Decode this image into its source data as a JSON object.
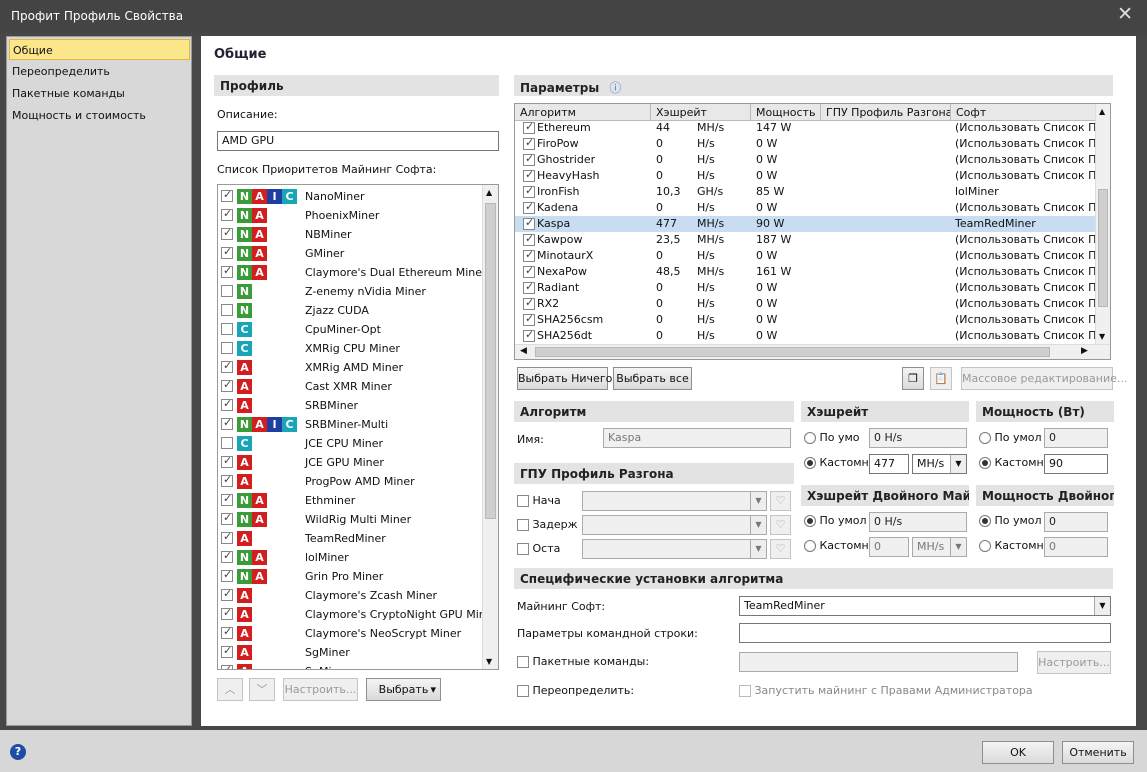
{
  "window": {
    "title": "Профит Профиль Свойства",
    "close": "✕"
  },
  "nav": {
    "items": [
      "Общие",
      "Переопределить",
      "Пакетные команды",
      "Мощность и стоимость"
    ]
  },
  "page_title": "Общие",
  "profile": {
    "section": "Профиль",
    "desc_label": "Описание:",
    "desc_value": "AMD GPU",
    "priority_label": "Список Приоритетов Майнинг Софта:"
  },
  "miners": [
    {
      "name": "NanoMiner",
      "on": true,
      "b": [
        "N",
        "A",
        "I",
        "C"
      ]
    },
    {
      "name": "PhoenixMiner",
      "on": true,
      "b": [
        "N",
        "A"
      ]
    },
    {
      "name": "NBMiner",
      "on": true,
      "b": [
        "N",
        "A"
      ]
    },
    {
      "name": "GMiner",
      "on": true,
      "b": [
        "N",
        "A"
      ]
    },
    {
      "name": "Claymore's Dual Ethereum Miner",
      "on": true,
      "b": [
        "N",
        "A"
      ]
    },
    {
      "name": "Z-enemy nVidia Miner",
      "on": false,
      "b": [
        "N"
      ]
    },
    {
      "name": "Zjazz CUDA",
      "on": false,
      "b": [
        "N"
      ]
    },
    {
      "name": "CpuMiner-Opt",
      "on": false,
      "b": [
        "C"
      ]
    },
    {
      "name": "XMRig CPU Miner",
      "on": false,
      "b": [
        "C"
      ]
    },
    {
      "name": "XMRig AMD Miner",
      "on": true,
      "b": [
        "A"
      ]
    },
    {
      "name": "Cast XMR Miner",
      "on": true,
      "b": [
        "A"
      ]
    },
    {
      "name": "SRBMiner",
      "on": true,
      "b": [
        "A"
      ]
    },
    {
      "name": "SRBMiner-Multi",
      "on": true,
      "b": [
        "N",
        "A",
        "I",
        "C"
      ]
    },
    {
      "name": "JCE CPU Miner",
      "on": false,
      "b": [
        "C"
      ]
    },
    {
      "name": "JCE GPU Miner",
      "on": true,
      "b": [
        "A"
      ]
    },
    {
      "name": "ProgPow AMD Miner",
      "on": true,
      "b": [
        "A"
      ]
    },
    {
      "name": "Ethminer",
      "on": true,
      "b": [
        "N",
        "A"
      ]
    },
    {
      "name": "WildRig Multi Miner",
      "on": true,
      "b": [
        "N",
        "A"
      ]
    },
    {
      "name": "TeamRedMiner",
      "on": true,
      "b": [
        "A"
      ]
    },
    {
      "name": "lolMiner",
      "on": true,
      "b": [
        "N",
        "A"
      ]
    },
    {
      "name": "Grin Pro Miner",
      "on": true,
      "b": [
        "N",
        "A"
      ]
    },
    {
      "name": "Claymore's Zcash Miner",
      "on": true,
      "b": [
        "A"
      ]
    },
    {
      "name": "Claymore's CryptoNight GPU Min...",
      "on": true,
      "b": [
        "A"
      ]
    },
    {
      "name": "Claymore's NeoScrypt Miner",
      "on": true,
      "b": [
        "A"
      ]
    },
    {
      "name": "SgMiner",
      "on": true,
      "b": [
        "A"
      ]
    },
    {
      "name": "SgMiner",
      "on": true,
      "b": [
        "A"
      ]
    }
  ],
  "list_buttons": {
    "up": "︿",
    "down": "﹀",
    "configure": "Настроить...",
    "choose": "Выбрать",
    "choose_arrow": "▾"
  },
  "params": {
    "section": "Параметры",
    "info_icon": "ⓘ",
    "headers": [
      "Алгоритм",
      "Хэшрейт",
      "Мощность",
      "ГПУ Профиль Разгона",
      "Софт"
    ],
    "rows": [
      [
        "Ethereum",
        "44",
        "MH/s",
        "147 W",
        "",
        "(Использовать Список При"
      ],
      [
        "FiroPow",
        "0",
        "H/s",
        "0 W",
        "",
        "(Использовать Список При"
      ],
      [
        "Ghostrider",
        "0",
        "H/s",
        "0 W",
        "",
        "(Использовать Список При"
      ],
      [
        "HeavyHash",
        "0",
        "H/s",
        "0 W",
        "",
        "(Использовать Список При"
      ],
      [
        "IronFish",
        "10,3",
        "GH/s",
        "85 W",
        "",
        "lolMiner"
      ],
      [
        "Kadena",
        "0",
        "H/s",
        "0 W",
        "",
        "(Использовать Список При"
      ],
      [
        "Kaspa",
        "477",
        "MH/s",
        "90 W",
        "",
        "TeamRedMiner"
      ],
      [
        "Kawpow",
        "23,5",
        "MH/s",
        "187 W",
        "",
        "(Использовать Список При"
      ],
      [
        "MinotaurX",
        "0",
        "H/s",
        "0 W",
        "",
        "(Использовать Список При"
      ],
      [
        "NexaPow",
        "48,5",
        "MH/s",
        "161 W",
        "",
        "(Использовать Список При"
      ],
      [
        "Radiant",
        "0",
        "H/s",
        "0 W",
        "",
        "(Использовать Список При"
      ],
      [
        "RX2",
        "0",
        "H/s",
        "0 W",
        "",
        "(Использовать Список При"
      ],
      [
        "SHA256csm",
        "0",
        "H/s",
        "0 W",
        "",
        "(Использовать Список При"
      ],
      [
        "SHA256dt",
        "0",
        "H/s",
        "0 W",
        "",
        "(Использовать Список При"
      ]
    ],
    "selected_row": 6,
    "select_none": "Выбрать Ничего",
    "select_all": "Выбрать все",
    "bulk_edit": "Массовое редактирование..."
  },
  "algo": {
    "section": "Алгоритм",
    "name_label": "Имя:",
    "name_value": "Kaspa"
  },
  "oc": {
    "section": "ГПУ Профиль Разгона",
    "rows": [
      "Нача",
      "Задерж",
      "Оста"
    ]
  },
  "hashrate": {
    "section": "Хэшрейт",
    "default_label": "По умо",
    "default_value": "0 H/s",
    "custom_label": "Кастомн",
    "custom_value": "477",
    "unit": "MH/s"
  },
  "power": {
    "section": "Мощность (Вт)",
    "default_label": "По умол",
    "default_value": "0",
    "custom_label": "Кастомн",
    "custom_value": "90"
  },
  "dual_hashrate": {
    "section": "Хэшрейт Двойного Майн...",
    "default_label": "По умол",
    "default_value": "0 H/s",
    "custom_label": "Кастомн",
    "custom_value": "0",
    "unit": "MH/s"
  },
  "dual_power": {
    "section": "Мощность Двойног...",
    "default_label": "По умол",
    "default_value": "0",
    "custom_label": "Кастомн",
    "custom_value": "0"
  },
  "specific": {
    "section": "Специфические установки алгоритма",
    "software_label": "Майнинг Софт:",
    "software_value": "TeamRedMiner",
    "cmdline_label": "Параметры командной строки:",
    "cmdline_value": "",
    "batch_label": "Пакетные команды:",
    "batch_value": "",
    "configure": "Настроить...",
    "override_label": "Переопределить:",
    "admin_label": "Запустить майнинг с Правами Администратора"
  },
  "footer": {
    "help": "?",
    "ok": "OK",
    "cancel": "Отменить"
  },
  "colors": {
    "selected_row": "#c8ddf2",
    "nav_selected": "#fbe68c",
    "badge_N": "#3a9c38",
    "badge_A": "#d11f1f",
    "badge_I": "#1f3ea3",
    "badge_C": "#18a6b6"
  }
}
